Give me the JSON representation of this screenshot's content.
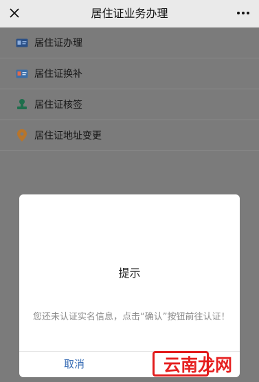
{
  "header": {
    "title": "居住证业务办理",
    "close_icon": "close-icon",
    "more_icon": "more-dots-icon"
  },
  "menu": {
    "items": [
      {
        "label": "居住证办理",
        "icon": "id-card-icon"
      },
      {
        "label": "居住证换补",
        "icon": "card-replace-icon"
      },
      {
        "label": "居住证核签",
        "icon": "stamp-icon"
      },
      {
        "label": "居住证地址变更",
        "icon": "location-pin-icon"
      }
    ]
  },
  "dialog": {
    "title": "提示",
    "message": "您还未认证实名信息，点击“确认”按钮前往认证！",
    "cancel_label": "取消"
  },
  "watermark": {
    "text": "云南龙网"
  },
  "colors": {
    "accent": "#3b6fb6",
    "highlight": "#e21b1b",
    "overlay": "#7b7b7b"
  }
}
